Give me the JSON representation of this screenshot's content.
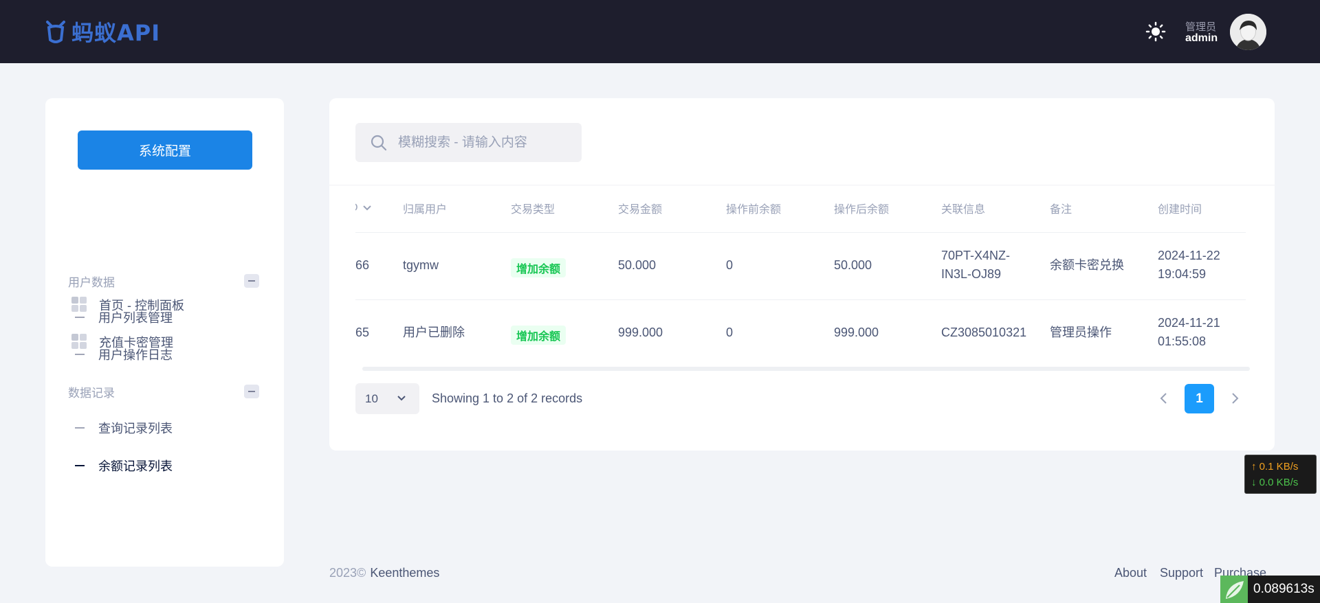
{
  "header": {
    "logo_text": "蚂蚁API",
    "user_role": "管理员",
    "user_name": "admin"
  },
  "sidebar": {
    "config_button": "系统配置",
    "items": [
      {
        "label": "首页 - 控制面板",
        "icon": "dashboard-icon"
      },
      {
        "label": "充值卡密管理",
        "icon": "grid-icon"
      }
    ],
    "sections": [
      {
        "title": "用户数据",
        "items": [
          "用户列表管理",
          "用户操作日志"
        ]
      },
      {
        "title": "数据记录",
        "items": [
          "查询记录列表",
          "余额记录列表"
        ]
      }
    ],
    "active_item": "余额记录列表"
  },
  "search": {
    "placeholder": "模糊搜索 - 请输入内容"
  },
  "table": {
    "columns": [
      "D",
      "归属用户",
      "交易类型",
      "交易金额",
      "操作前余额",
      "操作后余额",
      "关联信息",
      "备注",
      "创建时间"
    ],
    "rows": [
      {
        "id": "66",
        "user": "tgymw",
        "type": "增加余额",
        "amount": "50.000",
        "before": "0",
        "after": "50.000",
        "ref_line1": "70PT-X4NZ-",
        "ref_line2": "IN3L-OJ89",
        "note": "余额卡密兑换",
        "date": "2024-11-22",
        "time": "19:04:59"
      },
      {
        "id": "65",
        "user": "用户已删除",
        "type": "增加余额",
        "amount": "999.000",
        "before": "0",
        "after": "999.000",
        "ref_line1": "CZ3085010321",
        "ref_line2": "",
        "note": "管理员操作",
        "date": "2024-11-21",
        "time": "01:55:08"
      }
    ]
  },
  "pagination": {
    "page_size": "10",
    "records_text": "Showing 1 to 2 of 2 records",
    "current_page": "1"
  },
  "netspeed": {
    "up": "↑ 0.1 KB/s",
    "down": "↓ 0.0 KB/s"
  },
  "footer": {
    "copyright": "2023©",
    "brand": "Keenthemes",
    "links": [
      "About",
      "Support",
      "Purchase"
    ]
  },
  "timer": "0.089613s",
  "colors": {
    "header_bg": "#1e1e2d",
    "primary": "#1b84e6",
    "page_active": "#1b9cfc",
    "badge_green": "#17c653"
  }
}
